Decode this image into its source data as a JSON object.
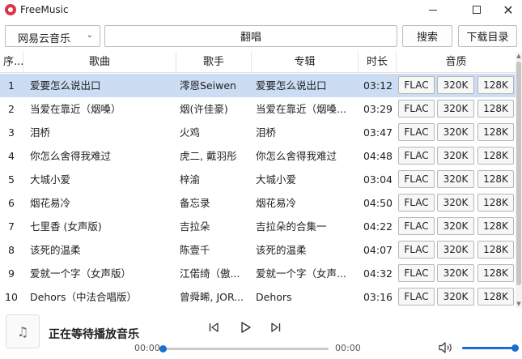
{
  "app": {
    "title": "FreeMusic"
  },
  "toolbar": {
    "source": "网易云音乐",
    "search_value": "翻唱",
    "search_label": "搜索",
    "download_dir_label": "下载目录"
  },
  "table": {
    "columns": [
      "序...",
      "歌曲",
      "歌手",
      "专辑",
      "时长",
      "音质"
    ],
    "quality_labels": [
      "FLAC",
      "320K",
      "128K"
    ],
    "rows": [
      {
        "index": "1",
        "title": "爱要怎么说出口",
        "artist": "澪恩Seiwen",
        "album": "爱要怎么说出口",
        "duration": "03:12"
      },
      {
        "index": "2",
        "title": "当爱在靠近（烟嗓）",
        "artist": "烟(许佳豪)",
        "album": "当爱在靠近（烟嗓...",
        "duration": "03:29"
      },
      {
        "index": "3",
        "title": "泪桥",
        "artist": "火鸡",
        "album": "泪桥",
        "duration": "03:47"
      },
      {
        "index": "4",
        "title": "你怎么舍得我难过",
        "artist": "虎二, 戴羽彤",
        "album": "你怎么舍得我难过",
        "duration": "04:48"
      },
      {
        "index": "5",
        "title": "大城小爱",
        "artist": "梓渝",
        "album": "大城小爱",
        "duration": "03:04"
      },
      {
        "index": "6",
        "title": "烟花易冷",
        "artist": "备忘录",
        "album": "烟花易冷",
        "duration": "04:50"
      },
      {
        "index": "7",
        "title": "七里香 (女声版)",
        "artist": "吉拉朵",
        "album": "吉拉朵的合集一",
        "duration": "04:22"
      },
      {
        "index": "8",
        "title": "该死的温柔",
        "artist": "陈壹千",
        "album": "该死的温柔",
        "duration": "04:07"
      },
      {
        "index": "9",
        "title": "爱就一个字（女声版）",
        "artist": "江偌绮（傲...",
        "album": "爱就一个字（女声...",
        "duration": "04:32"
      },
      {
        "index": "10",
        "title": "Dehors（中法合唱版）",
        "artist": "曾舜晞, JOR...",
        "album": "Dehors",
        "duration": "03:16"
      }
    ]
  },
  "player": {
    "now_playing": "正在等待播放音乐",
    "current_time": "00:00",
    "total_time": "00:00",
    "progress": 0,
    "volume": 1.0
  },
  "colors": {
    "accent": "#1b6fd1",
    "selected_row": "#ccdcf3",
    "logo": "#e0334a"
  },
  "icons": {
    "logo": "netease-cloud-music-logo",
    "cover": "music-note-icon",
    "prev": "skip-previous-icon",
    "play": "play-icon",
    "next": "skip-next-icon",
    "volume": "volume-icon"
  }
}
